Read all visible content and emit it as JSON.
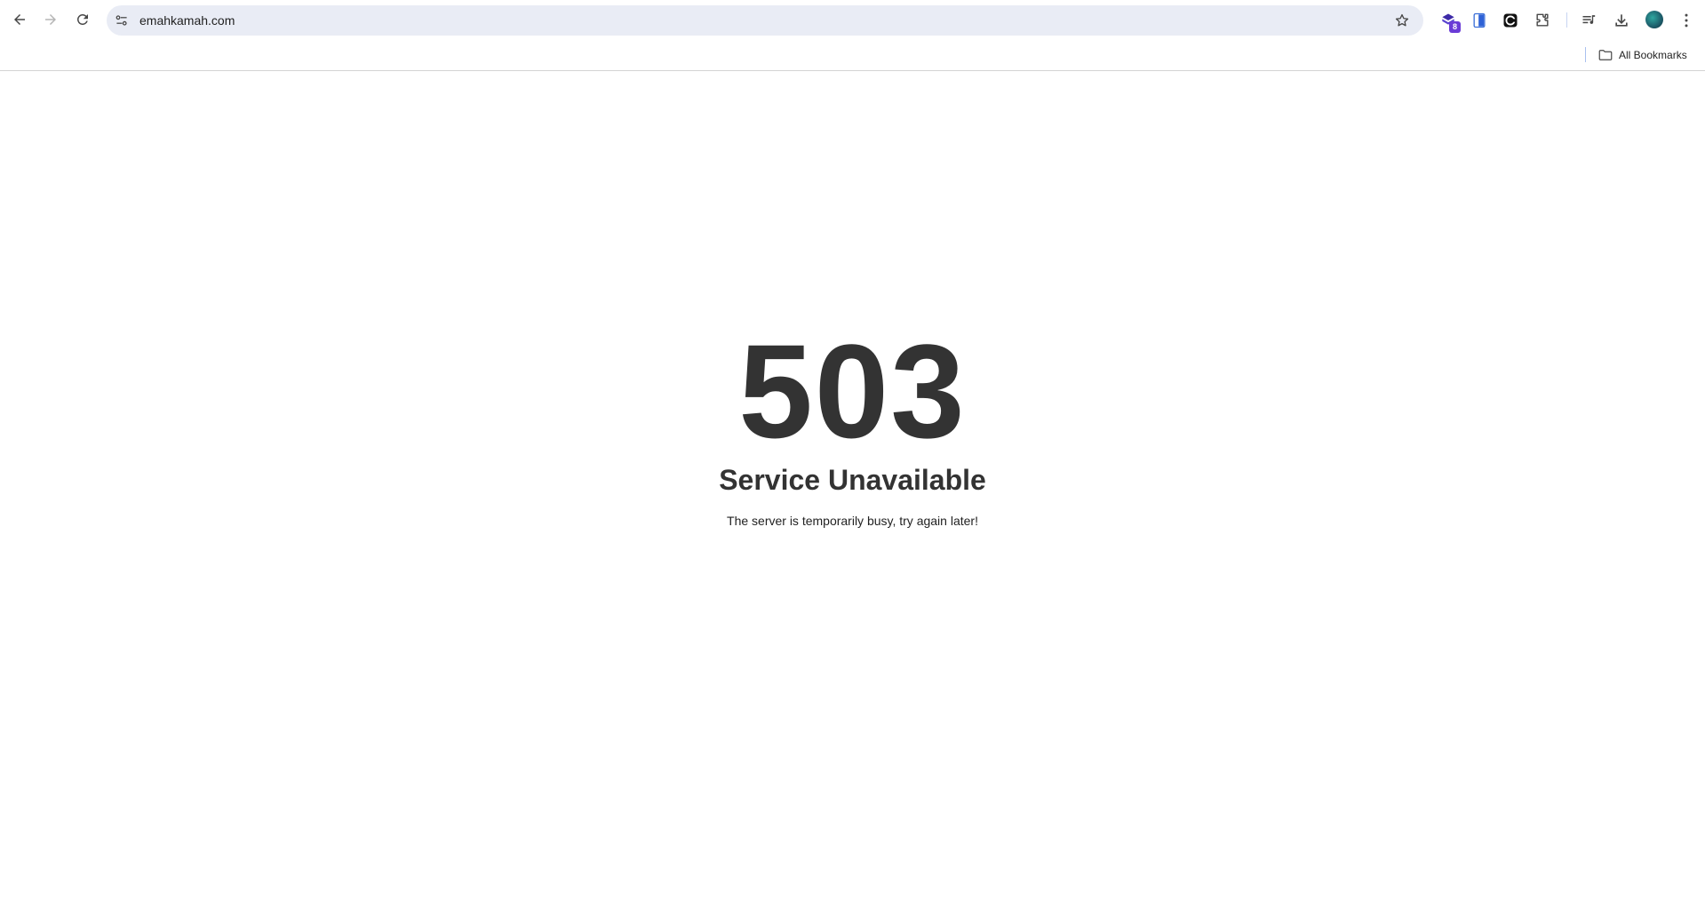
{
  "browser": {
    "url": "emahkamah.com",
    "extension_badge": "8",
    "bookmarks": {
      "all_bookmarks_label": "All Bookmarks"
    },
    "icons": {
      "back": "arrow-left-icon",
      "forward": "arrow-right-icon",
      "reload": "reload-icon",
      "site_info": "tune-icon",
      "bookmark_star": "star-outline-icon",
      "extension_1": "extension-badge-icon",
      "extension_2": "blue-card-icon",
      "extension_3": "c-logo-icon",
      "extensions": "puzzle-icon",
      "reading_list": "playlist-icon",
      "downloads": "download-icon",
      "profile": "avatar-icon",
      "menu": "kebab-menu-icon",
      "folder": "folder-icon"
    }
  },
  "page": {
    "error_code": "503",
    "title": "Service Unavailable",
    "message": "The server is temporarily busy, try again later!",
    "text_color": "#333333"
  }
}
